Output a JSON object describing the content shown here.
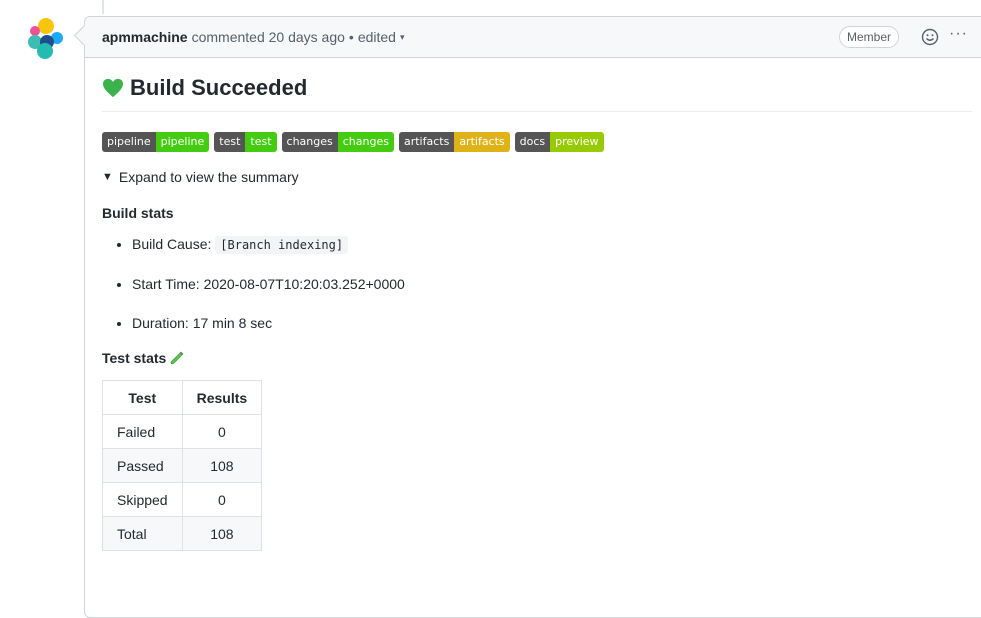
{
  "comment": {
    "author": "apmmachine",
    "action": "commented 20 days ago",
    "separator": "•",
    "edited": "edited",
    "edited_caret": "▾",
    "role_badge": "Member",
    "more_label": "···"
  },
  "content": {
    "heading": "Build Succeeded",
    "heading_icon": "green-heart-icon",
    "badges": [
      {
        "left": "pipeline",
        "right": "pipeline",
        "color": "#4c1"
      },
      {
        "left": "test",
        "right": "test",
        "color": "#4c1"
      },
      {
        "left": "changes",
        "right": "changes",
        "color": "#4c1"
      },
      {
        "left": "artifacts",
        "right": "artifacts",
        "color": "#dfb317"
      },
      {
        "left": "docs",
        "right": "preview",
        "color": "#97ca00"
      }
    ],
    "summary_toggle": "Expand to view the summary",
    "summary_marker": "▼",
    "build_stats_title": "Build stats",
    "build_stats": [
      {
        "label": "Build Cause: ",
        "code": "[Branch indexing]"
      },
      {
        "label": "Start Time: 2020-08-07T10:20:03.252+0000"
      },
      {
        "label": "Duration: 17 min 8 sec"
      }
    ],
    "test_stats_title": "Test stats",
    "test_table": {
      "headers": [
        "Test",
        "Results"
      ],
      "rows": [
        [
          "Failed",
          "0"
        ],
        [
          "Passed",
          "108"
        ],
        [
          "Skipped",
          "0"
        ],
        [
          "Total",
          "108"
        ]
      ]
    }
  }
}
